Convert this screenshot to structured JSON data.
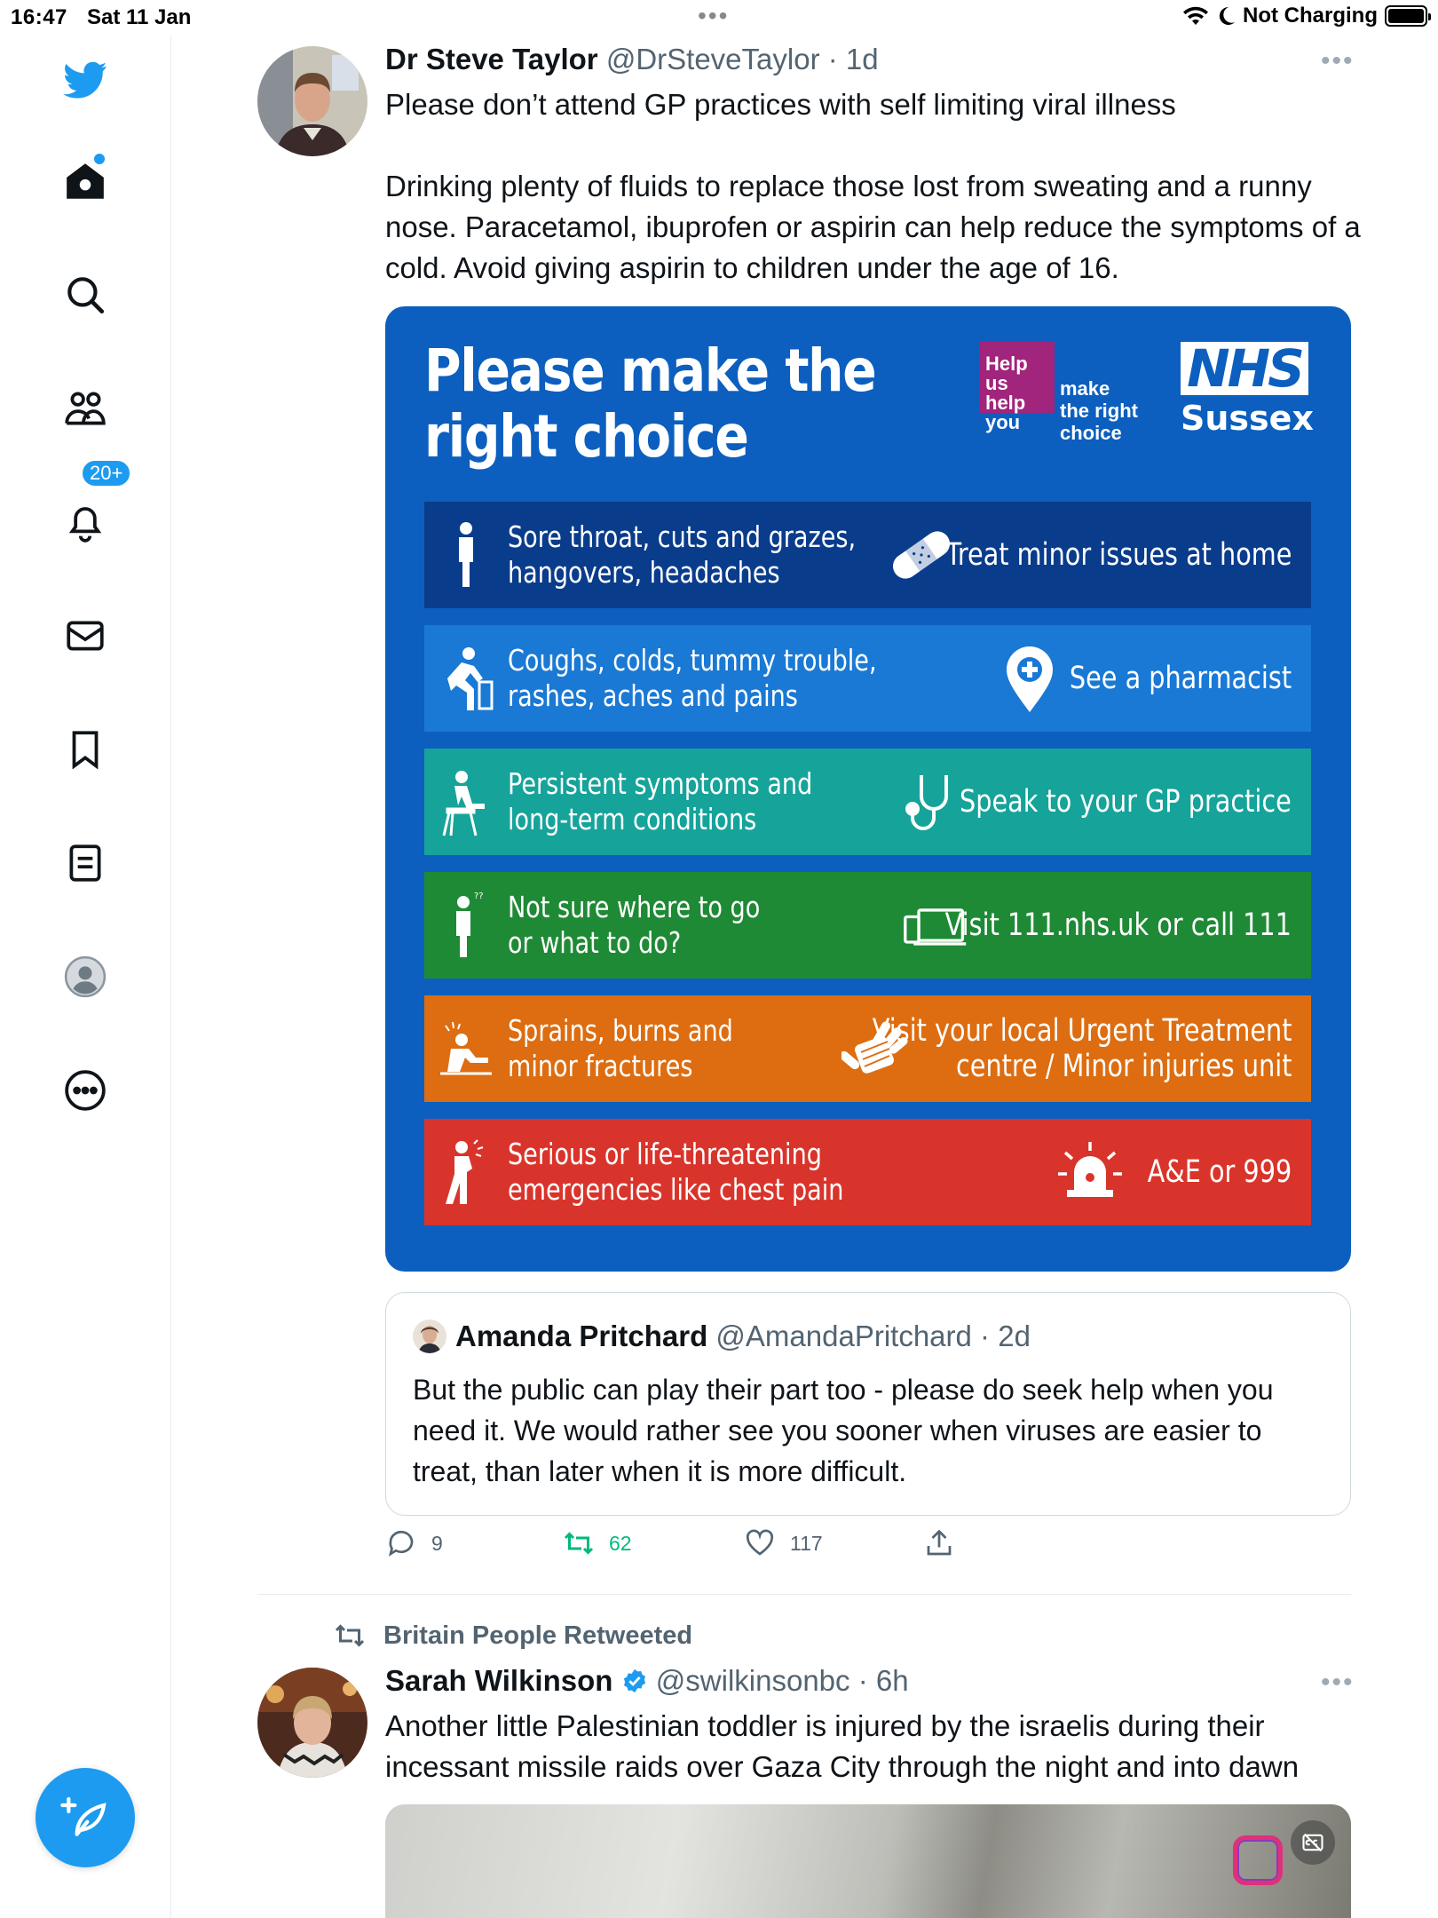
{
  "status_bar": {
    "time": "16:47",
    "date": "Sat 11 Jan",
    "battery_label": "Not Charging"
  },
  "sidebar": {
    "notification_badge": "20+",
    "items": [
      {
        "icon": "twitter-bird-icon"
      },
      {
        "icon": "home-icon"
      },
      {
        "icon": "search-icon"
      },
      {
        "icon": "communities-icon"
      },
      {
        "icon": "notifications-bell-icon"
      },
      {
        "icon": "messages-icon"
      },
      {
        "icon": "bookmarks-icon"
      },
      {
        "icon": "lists-icon"
      },
      {
        "icon": "profile-avatar-icon"
      },
      {
        "icon": "more-circle-icon"
      }
    ]
  },
  "tweet1": {
    "name": "Dr Steve Taylor",
    "handle": "@DrSteveTaylor",
    "time": " · 1d",
    "text_line1": "Please don’t attend GP practices with self limiting viral illness",
    "text_para2": "Drinking plenty of fluids to replace those lost from sweating and a runny nose. Paracetamol, ibuprofen or aspirin can help reduce the symptoms of a cold. Avoid giving aspirin to children under the age of 16.",
    "image": {
      "title_line1": "Please make the",
      "title_line2": "right choice",
      "helpus_line1": "Help us",
      "helpus_line2": "help you",
      "helpus_side1": "make",
      "helpus_side2": "the right",
      "helpus_side3": "choice",
      "nhs_logo": "NHS",
      "nhs_region": "Sussex",
      "rows": [
        {
          "left1": "Sore throat, cuts and grazes,",
          "left2": "hangovers, headaches",
          "right1": "Treat minor issues at home",
          "right2": "",
          "color": "#0a3c8c"
        },
        {
          "left1": "Coughs, colds, tummy trouble,",
          "left2": "rashes, aches and pains",
          "right1": "See a pharmacist",
          "right2": "",
          "color": "#1a79d4"
        },
        {
          "left1": "Persistent symptoms and",
          "left2": "long-term conditions",
          "right1": "Speak to your GP practice",
          "right2": "",
          "color": "#16a39a"
        },
        {
          "left1": "Not sure where to go",
          "left2": "or what to do?",
          "right1": "Visit 111.nhs.uk or call 111",
          "right2": "",
          "color": "#1f8a35"
        },
        {
          "left1": "Sprains, burns and",
          "left2": "minor fractures",
          "right1": "Visit your local Urgent Treatment",
          "right2": "centre / Minor injuries unit",
          "color": "#dd6d10"
        },
        {
          "left1": "Serious or life-threatening",
          "left2": "emergencies like chest pain",
          "right1": "A&E or 999",
          "right2": "",
          "color": "#d9342b"
        }
      ]
    },
    "quote": {
      "name": "Amanda Pritchard",
      "handle": "@AmandaPritchard",
      "time": " · 2d",
      "text": "But the public can play their part too - please do seek help when you need it. We would rather see you sooner when viruses are easier to treat, than later when it is more difficult."
    },
    "actions": {
      "replies": "9",
      "retweets": "62",
      "likes": "117"
    }
  },
  "tweet2": {
    "retweeted_by": "Britain People Retweeted",
    "name": "Sarah Wilkinson",
    "handle": "@swilkinsonbc",
    "time": " · 6h",
    "text": "Another little Palestinian toddler is injured by the israelis during their incessant missile raids over Gaza City through the night and into dawn"
  },
  "colors": {
    "accent": "#1d9bf0",
    "nhs_blue": "#0c5fbf",
    "retweet_green": "#00ba7c",
    "help_us_purple": "#a1257c"
  }
}
